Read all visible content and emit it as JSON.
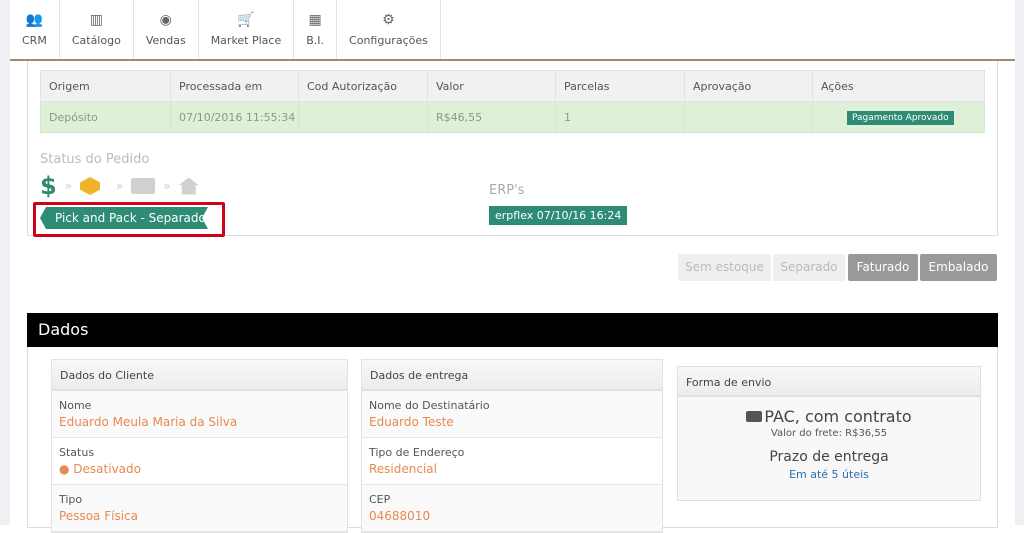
{
  "nav": {
    "items": [
      {
        "label": "CRM",
        "icon": "users-icon",
        "glyph": "👥"
      },
      {
        "label": "Catálogo",
        "icon": "barcode-icon",
        "glyph": "▥"
      },
      {
        "label": "Vendas",
        "icon": "eye-icon",
        "glyph": "◉"
      },
      {
        "label": "Market Place",
        "icon": "cart-icon",
        "glyph": "🛒"
      },
      {
        "label": "B.I.",
        "icon": "bar-chart-icon",
        "glyph": "▦"
      },
      {
        "label": "Configurações",
        "icon": "gear-icon",
        "glyph": "⚙"
      }
    ]
  },
  "payments": {
    "columns": [
      "Origem",
      "Processada em",
      "Cod Autorização",
      "Valor",
      "Parcelas",
      "Aprovação",
      "Ações"
    ],
    "rows": [
      {
        "origem": "Depósito",
        "processada": "07/10/2016 11:55:34",
        "cod": "",
        "valor": "R$46,55",
        "parcelas": "1",
        "aprovacao": "",
        "acao": "Pagamento Aprovado"
      }
    ]
  },
  "status": {
    "title": "Status do Pedido",
    "dollar": "$",
    "sep": "»",
    "current": "Pick and Pack - Separado"
  },
  "erp": {
    "title": "ERP's",
    "badge": "erpflex 07/10/16 16:24"
  },
  "actions": {
    "sem_estoque": "Sem estoque",
    "separado": "Separado",
    "faturado": "Faturado",
    "embalado": "Embalado"
  },
  "dados": {
    "title": "Dados",
    "cliente": {
      "title": "Dados do Cliente",
      "fields": [
        {
          "label": "Nome",
          "value": "Eduardo Meula Maria da Silva"
        },
        {
          "label": "Status",
          "value": "Desativado"
        },
        {
          "label": "Tipo",
          "value": "Pessoa Física"
        }
      ]
    },
    "entrega": {
      "title": "Dados de entrega",
      "fields": [
        {
          "label": "Nome do Destinatário",
          "value": "Eduardo Teste"
        },
        {
          "label": "Tipo de Endereço",
          "value": "Residencial"
        },
        {
          "label": "CEP",
          "value": "04688010"
        }
      ]
    },
    "envio": {
      "title": "Forma de envio",
      "method": "PAC, com contrato",
      "frete": "Valor do frete: R$36,55",
      "prazo_title": "Prazo de entrega",
      "prazo": "Em até 5 úteis"
    }
  },
  "colors": {
    "accent": "#2e8b74",
    "value": "#e8894f",
    "highlight": "#d0021b",
    "link": "#2a6fb0"
  }
}
